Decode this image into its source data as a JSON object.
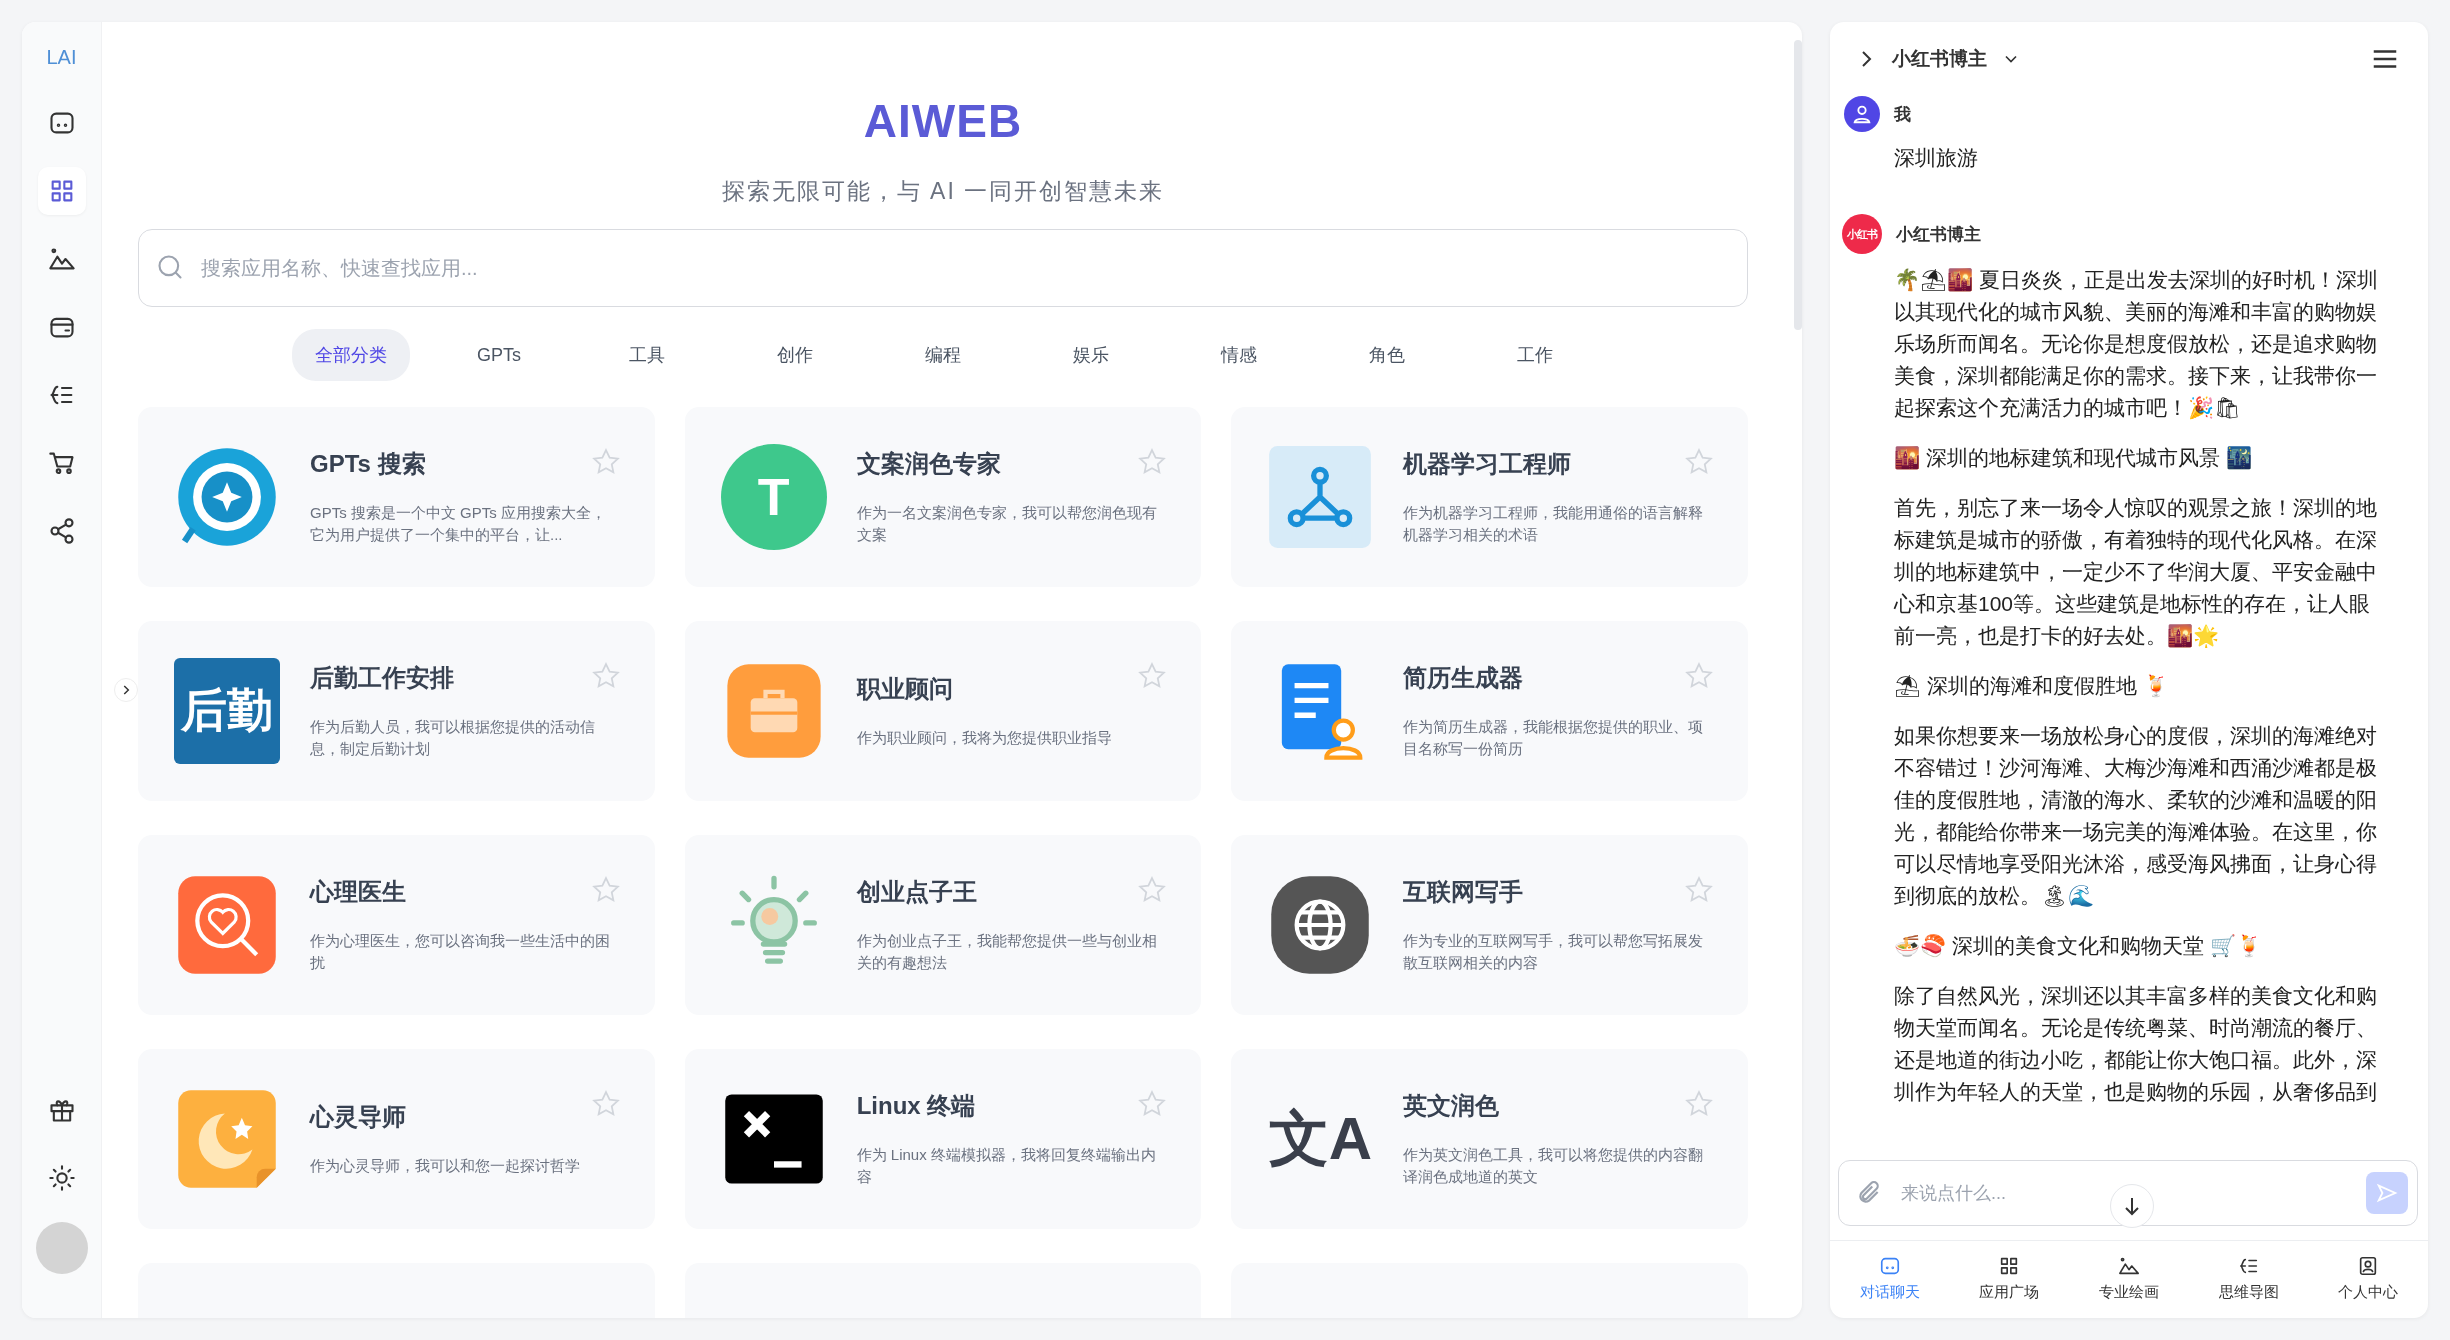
{
  "sidebar": {
    "logo": "LAI",
    "items": [
      {
        "kind": "chat",
        "selected": false
      },
      {
        "kind": "grid",
        "selected": true
      },
      {
        "kind": "mountain",
        "selected": false
      },
      {
        "kind": "wallet",
        "selected": false
      },
      {
        "kind": "mindmap",
        "selected": false
      },
      {
        "kind": "cart",
        "selected": false
      },
      {
        "kind": "share",
        "selected": false
      }
    ],
    "bottom_items": [
      {
        "kind": "gift"
      },
      {
        "kind": "sun"
      }
    ]
  },
  "header": {
    "title": "AIWEB",
    "subtitle": "探索无限可能，与 AI 一同开创智慧未来"
  },
  "search": {
    "placeholder": "搜索应用名称、快速查找应用..."
  },
  "tabs": [
    {
      "label": "全部分类",
      "selected": true
    },
    {
      "label": "GPTs",
      "selected": false
    },
    {
      "label": "工具",
      "selected": false
    },
    {
      "label": "创作",
      "selected": false
    },
    {
      "label": "编程",
      "selected": false
    },
    {
      "label": "娱乐",
      "selected": false
    },
    {
      "label": "情感",
      "selected": false
    },
    {
      "label": "角色",
      "selected": false
    },
    {
      "label": "工作",
      "selected": false
    }
  ],
  "apps": [
    {
      "kind": "search",
      "title": "GPTs 搜索",
      "description": "GPTs 搜索是一个中文 GPTs 应用搜索大全，它为用户提供了一个集中的平台，让...",
      "starred": false
    },
    {
      "kind": "lettertile",
      "icon_text": "T",
      "title": "文案润色专家",
      "description": "作为一名文案润色专家，我可以帮您润色现有文案",
      "starred": false
    },
    {
      "kind": "molecule",
      "title": "机器学习工程师",
      "description": "作为机器学习工程师，我能用通俗的语言解释机器学习相关的术语",
      "starred": false
    },
    {
      "kind": "textlogo",
      "icon_text": "后勤",
      "title": "后勤工作安排",
      "description": "作为后勤人员，我可以根据您提供的活动信息，制定后勤计划",
      "starred": false
    },
    {
      "kind": "briefcase",
      "title": "职业顾问",
      "description": "作为职业顾问，我将为您提供职业指导",
      "starred": false
    },
    {
      "kind": "resume",
      "title": "简历生成器",
      "description": "作为简历生成器，我能根据您提供的职业、项目名称写一份简历",
      "starred": false
    },
    {
      "kind": "heart",
      "title": "心理医生",
      "description": "作为心理医生，您可以咨询我一些生活中的困扰",
      "starred": false
    },
    {
      "kind": "bulb",
      "title": "创业点子王",
      "description": "作为创业点子王，我能帮您提供一些与创业相关的有趣想法",
      "starred": false
    },
    {
      "kind": "globe",
      "title": "互联网写手",
      "description": "作为专业的互联网写手，我可以帮您写拓展发散互联网相关的内容",
      "starred": false
    },
    {
      "kind": "moon",
      "title": "心灵导师",
      "description": "作为心灵导师，我可以和您一起探讨哲学",
      "starred": false
    },
    {
      "kind": "terminal",
      "title": "Linux 终端",
      "description": "作为 Linux 终端模拟器，我将回复终端输出内容",
      "starred": false
    },
    {
      "kind": "translate",
      "icon_text": "文A",
      "title": "英文润色",
      "description": "作为英文润色工具，我可以将您提供的内容翻译润色成地道的英文",
      "starred": false
    }
  ],
  "chat": {
    "bot_name": "小红书博主",
    "messages": [
      {
        "kind": "user",
        "name": "我",
        "paragraphs": [
          "深圳旅游"
        ]
      },
      {
        "kind": "bot",
        "name": "小红书博主",
        "avatar_text": "小红书",
        "paragraphs": [
          "🌴⛱🌇 夏日炎炎，正是出发去深圳的好时机！深圳以其现代化的城市风貌、美丽的海滩和丰富的购物娱乐场所而闻名。无论你是想度假放松，还是追求购物美食，深圳都能满足你的需求。接下来，让我带你一起探索这个充满活力的城市吧！🎉🛍",
          "🌇 深圳的地标建筑和现代城市风景 🌃",
          "首先，别忘了来一场令人惊叹的观景之旅！深圳的地标建筑是城市的骄傲，有着独特的现代化风格。在深圳的地标建筑中，一定少不了华润大厦、平安金融中心和京基100等。这些建筑是地标性的存在，让人眼前一亮，也是打卡的好去处。🌇🌟",
          "⛱ 深圳的海滩和度假胜地 🍹",
          "如果你想要来一场放松身心的度假，深圳的海滩绝对不容错过！沙河海滩、大梅沙海滩和西涌沙滩都是极佳的度假胜地，清澈的海水、柔软的沙滩和温暖的阳光，都能给你带来一场完美的海滩体验。在这里，你可以尽情地享受阳光沐浴，感受海风拂面，让身心得到彻底的放松。🏝🌊",
          "🍜🍣 深圳的美食文化和购物天堂 🛒🍹",
          "除了自然风光，深圳还以其丰富多样的美食文化和购物天堂而闻名。无论是传统粤菜、时尚潮流的餐厅、还是地道的街边小吃，都能让你大饱口福。此外，深圳作为年轻人的天堂，也是购物的乐园，从奢侈品到"
        ]
      }
    ]
  },
  "composer": {
    "placeholder": "来说点什么..."
  },
  "bottom_nav": [
    {
      "kind": "chat",
      "label": "对话聊天",
      "selected": true
    },
    {
      "kind": "grid",
      "label": "应用广场",
      "selected": false
    },
    {
      "kind": "mountain",
      "label": "专业绘画",
      "selected": false
    },
    {
      "kind": "mindmap",
      "label": "思维导图",
      "selected": false
    },
    {
      "kind": "profile",
      "label": "个人中心",
      "selected": false
    }
  ]
}
